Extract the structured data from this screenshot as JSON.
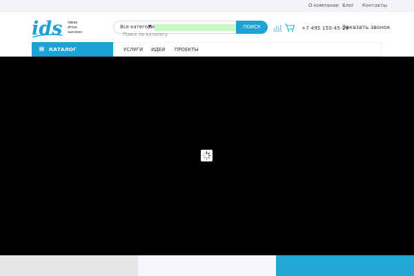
{
  "topbar": {
    "links": [
      "О компании",
      "Блог",
      "Контакты"
    ]
  },
  "logo": {
    "mark": "ids",
    "tagline": [
      "ideas",
      "drive",
      "success"
    ]
  },
  "search": {
    "category": "Все категории",
    "button_label": "ПОИСК",
    "input_value": "",
    "hint": "Поиск по каталогу"
  },
  "header": {
    "phone": "+7 495 150-45-19",
    "callback": "Заказать звонок"
  },
  "nav": {
    "catalog_label": "КАТАЛОГ",
    "links": [
      "УСЛУГИ",
      "ИДЕИ",
      "ПРОЕКТЫ"
    ]
  },
  "colors": {
    "accent": "#1aa3d4",
    "search_field": "#c9f7c6",
    "hero": "#000000",
    "footer_blocks": [
      "#e7e7e7",
      "#f5f7fb",
      "#21a7d4"
    ]
  },
  "icons": [
    "compare-chart-icon",
    "cart-icon",
    "menu-bars-icon",
    "loading-spinner-icon"
  ]
}
